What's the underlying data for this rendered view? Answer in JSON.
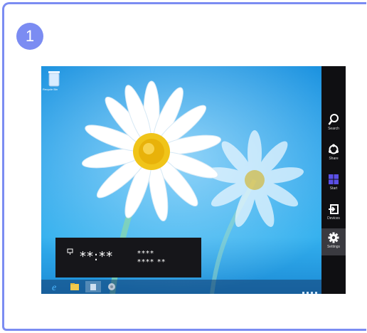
{
  "step": {
    "number": "1"
  },
  "desktop": {
    "recycle_bin_label": "Recycle Bin"
  },
  "charms": [
    {
      "label": "Search",
      "icon": "search-icon",
      "selected": false
    },
    {
      "label": "Share",
      "icon": "share-icon",
      "selected": false
    },
    {
      "label": "Start",
      "icon": "windows-start-icon",
      "selected": false
    },
    {
      "label": "Devices",
      "icon": "devices-icon",
      "selected": false
    },
    {
      "label": "Settings",
      "icon": "gear-icon",
      "selected": true
    }
  ],
  "clock": {
    "time": "**:**",
    "date_line1": "****",
    "date_line2": "**** **"
  },
  "taskbar": {
    "items": [
      "internet-explorer-icon",
      "file-explorer-icon",
      "store-icon",
      "media-icon"
    ]
  },
  "colors": {
    "accent": "#7b8cf2",
    "charm_bar": "#0f0f12",
    "start_tile": "#5a4fe6",
    "desktop_blue": "#2aa4ea"
  }
}
